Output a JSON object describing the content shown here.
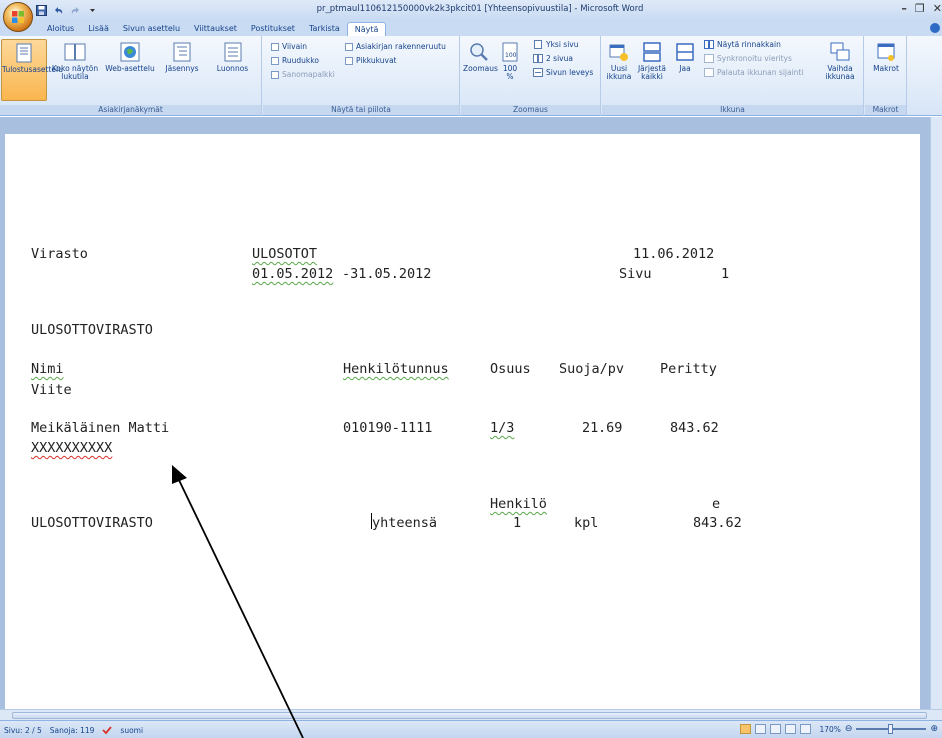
{
  "window": {
    "title": "pr_ptmaul110612150000vk2k3pkcit01 [Yhteensopivuustila] - Microsoft Word"
  },
  "tabs": [
    "Aloitus",
    "Lisää",
    "Sivun asettelu",
    "Viittaukset",
    "Postitukset",
    "Tarkista",
    "Näytä"
  ],
  "active_tab": "Näytä",
  "ribbon": {
    "views": {
      "label": "Asiakirjanäkymät",
      "print_layout": "Tulostusasettelu",
      "full_screen": "Koko näytön lukutila",
      "web_layout": "Web-asettelu",
      "outline": "Jäsennys",
      "draft": "Luonnos"
    },
    "show_hide": {
      "label": "Näytä tai piilota",
      "ruler": "Viivain",
      "gridlines": "Ruudukko",
      "message_bar": "Sanomapalkki",
      "doc_map": "Asiakirjan rakenneruutu",
      "thumbnails": "Pikkukuvat"
    },
    "zoom": {
      "label": "Zoomaus",
      "zoom": "Zoomaus",
      "hundred_top": "100",
      "hundred_bottom": "%",
      "one_page": "Yksi sivu",
      "two_pages": "2 sivua",
      "page_width": "Sivun leveys"
    },
    "window": {
      "label": "Ikkuna",
      "new_line1": "Uusi",
      "new_line2": "ikkuna",
      "arrange_line1": "Järjestä",
      "arrange_line2": "kaikki",
      "split": "Jaa",
      "side_by_side": "Näytä rinnakkain",
      "sync_scroll": "Synkronoitu vieritys",
      "reset_pos": "Palauta ikkunan sijainti",
      "switch_line1": "Vaihda",
      "switch_line2": "ikkunaa"
    },
    "macros": {
      "label": "Makrot",
      "macros": "Makrot"
    }
  },
  "document": {
    "l1a": "Virasto",
    "l1b": "ULOSOTOT",
    "l1c": "11.06.2012",
    "l2a": "01.05.2012",
    "l2b": "-31.05.2012",
    "l2c": "Sivu",
    "l2d": "1",
    "l3": "ULOSOTTOVIRASTO",
    "h_name": "Nimi",
    "h_ssn": "Henkilötunnus",
    "h_share": "Osuus",
    "h_prot": "Suoja/pv",
    "h_col": "Peritty",
    "h_ref": "Viite",
    "r_name": "Meikäläinen Matti",
    "r_ssn": "010190-1111",
    "r_share": "1/3",
    "r_prot_a": "21",
    "r_prot_b": ".69",
    "r_col": "843.62",
    "r_ref": "XXXXXXXXXX",
    "t_person": "Henkilö",
    "t_e": "e",
    "t_name": "ULOSOTTOVIRASTO",
    "t_total": "yhteensä",
    "t_count": "1",
    "t_unit": "kpl",
    "t_sum": "843.62"
  },
  "status": {
    "page": "Sivu: 2 / 5",
    "words": "Sanoja: 119",
    "language": "suomi",
    "zoom": "170%"
  }
}
